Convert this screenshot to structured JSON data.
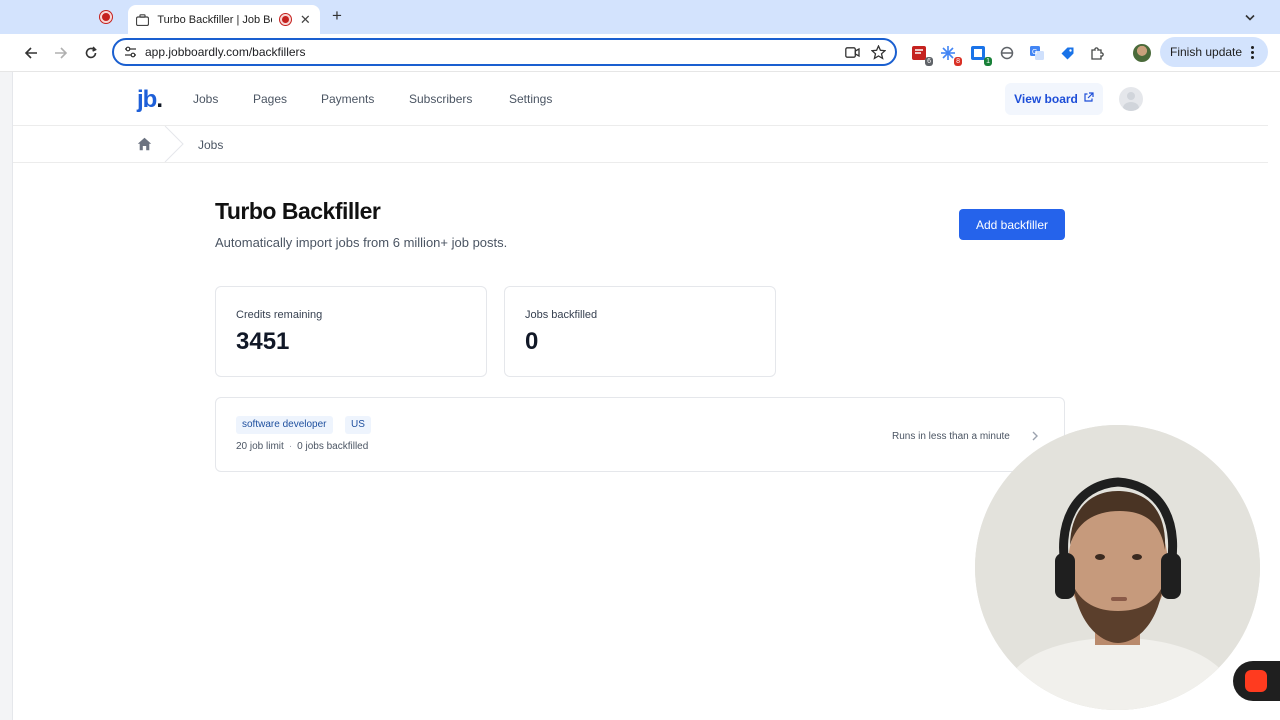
{
  "browser": {
    "tab_title": "Turbo Backfiller | Job Boardly",
    "url": "app.jobboardly.com/backfillers",
    "finish_update_label": "Finish update",
    "extensions": [
      {
        "icon": "pdf-extension-icon",
        "badge": "6",
        "color": "#c5221f"
      },
      {
        "icon": "spark-extension-icon",
        "badge": "8",
        "color": "#d93025"
      },
      {
        "icon": "sheets-extension-icon",
        "badge": "1",
        "color": "#188038"
      },
      {
        "icon": "circle-extension-icon",
        "badge": "",
        "color": "#5f6368"
      },
      {
        "icon": "translate-extension-icon",
        "badge": "",
        "color": "#4285f4"
      },
      {
        "icon": "tag-extension-icon",
        "badge": "",
        "color": "#1a73e8"
      },
      {
        "icon": "puzzle-extensions-icon",
        "badge": "",
        "color": "#444746"
      }
    ]
  },
  "app": {
    "logo_text": "jb",
    "logo_dot": ".",
    "nav": {
      "jobs": "Jobs",
      "pages": "Pages",
      "payments": "Payments",
      "subscribers": "Subscribers",
      "settings": "Settings"
    },
    "view_board_label": "View board",
    "breadcrumb": {
      "current": "Jobs"
    },
    "accent_color": "#2563eb"
  },
  "main": {
    "title": "Turbo Backfiller",
    "subtitle": "Automatically import jobs from 6 million+ job posts.",
    "add_button_label": "Add backfiller",
    "stats": {
      "credits_label": "Credits remaining",
      "credits_value": "3451",
      "jobs_label": "Jobs backfilled",
      "jobs_value": "0"
    },
    "backfillers": [
      {
        "tags": [
          "software developer",
          "US"
        ],
        "limit": "20 job limit",
        "separator": "·",
        "backfilled": "0 jobs backfilled",
        "runs": "Runs in less than a minute"
      }
    ]
  }
}
